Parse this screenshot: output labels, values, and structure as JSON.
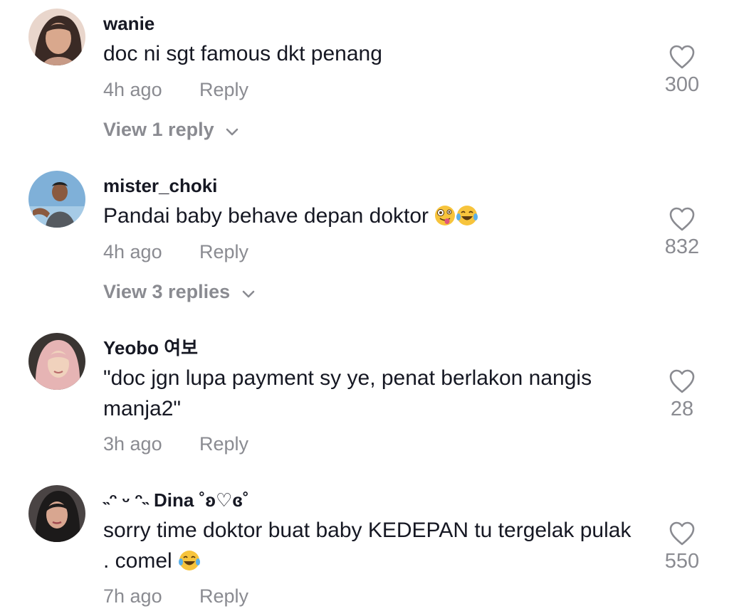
{
  "comments": [
    {
      "username": "wanie",
      "text": "doc ni sgt famous dkt penang",
      "time": "4h ago",
      "reply_label": "Reply",
      "likes": "300",
      "view_replies": "View 1 reply"
    },
    {
      "username": "mister_choki",
      "text": "Pandai baby behave depan doktor",
      "emojis": [
        "zany-face-emoji",
        "tears-of-joy-emoji"
      ],
      "time": "4h ago",
      "reply_label": "Reply",
      "likes": "832",
      "view_replies": "View 3 replies"
    },
    {
      "username": "Yeobo 여보",
      "text": "\"doc jgn lupa payment sy ye, penat berlakon nangis manja2\"",
      "time": "3h ago",
      "reply_label": "Reply",
      "likes": "28"
    },
    {
      "username": "˵ᵔ ᵕ ᵔ˵ Dina ˚ʚ♡ɞ˚",
      "text": "sorry time doktor buat baby KEDEPAN tu tergelak pulak . comel",
      "emojis": [
        "tears-of-joy-emoji"
      ],
      "time": "7h ago",
      "reply_label": "Reply",
      "likes": "550"
    }
  ],
  "colors": {
    "primary_text": "#161823",
    "secondary_text": "#8a8b91",
    "background": "#ffffff"
  },
  "icons": {
    "like": "heart-outline-icon",
    "expand": "chevron-down-icon"
  }
}
